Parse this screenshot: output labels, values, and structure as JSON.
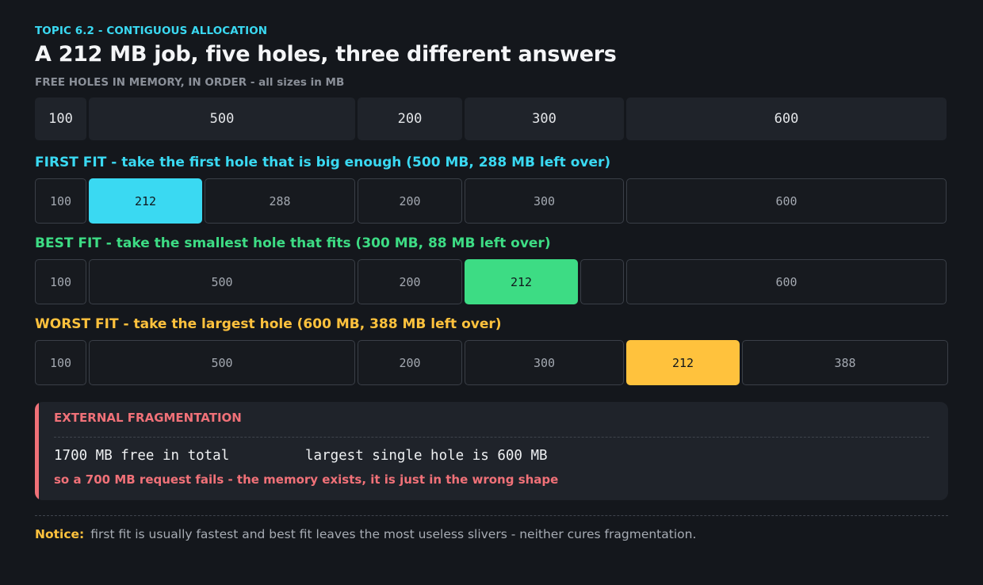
{
  "header": {
    "topic": "TOPIC 6.2  -  CONTIGUOUS ALLOCATION",
    "title": "A 212 MB job, five holes, three different answers",
    "subtitle": "FREE HOLES IN MEMORY, IN ORDER  -",
    "subtitle_note": "all sizes in MB"
  },
  "colors": {
    "first_fit": "#3ad9f2",
    "best_fit": "#3ddc84",
    "worst_fit": "#ffc23d",
    "fragmentation": "#f07178"
  },
  "holes": [
    "100",
    "500",
    "200",
    "300",
    "600"
  ],
  "first_fit": {
    "label": "FIRST FIT  -  take the first hole that is big enough  (500 MB, 288 MB left over)",
    "cells": [
      "100",
      "212",
      "288",
      "200",
      "300",
      "600"
    ]
  },
  "best_fit": {
    "label": "BEST FIT  -  take the smallest hole that fits  (300 MB, 88 MB left over)",
    "cells": [
      "100",
      "500",
      "200",
      "212",
      "600"
    ]
  },
  "worst_fit": {
    "label": "WORST FIT  -  take the largest hole  (600 MB, 388 MB left over)",
    "cells": [
      "100",
      "500",
      "200",
      "300",
      "212",
      "388"
    ]
  },
  "fragmentation": {
    "heading": "EXTERNAL FRAGMENTATION",
    "total_free": "1700 MB free in total",
    "largest_hole": "largest single hole is 600 MB",
    "consequence": "so a 700 MB request fails  -  the memory exists, it is just in the wrong shape"
  },
  "notice": {
    "label": "Notice:",
    "text": "first fit is usually fastest and best fit leaves the most useless slivers - neither cures fragmentation."
  }
}
